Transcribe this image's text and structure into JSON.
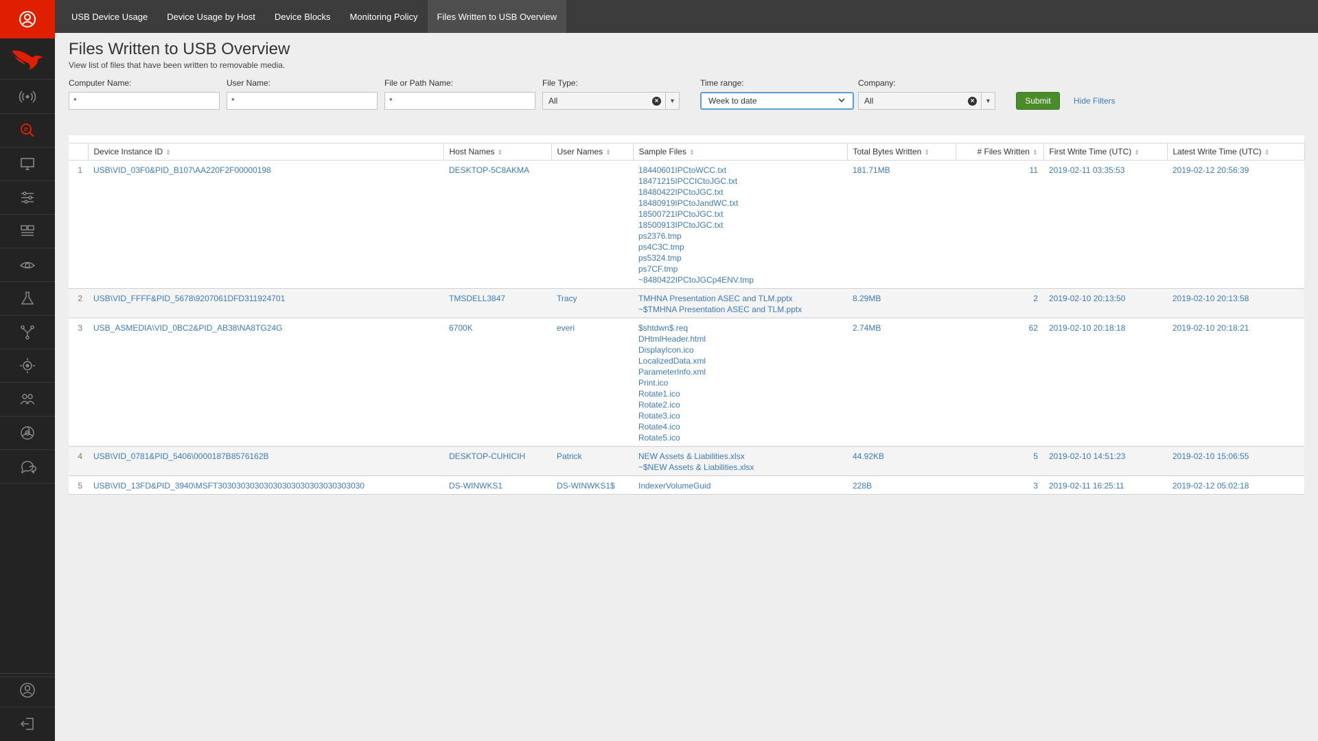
{
  "nav": {
    "tabs": [
      {
        "label": "USB Device Usage"
      },
      {
        "label": "Device Usage by Host"
      },
      {
        "label": "Device Blocks"
      },
      {
        "label": "Monitoring Policy"
      },
      {
        "label": "Files Written to USB Overview",
        "active": true
      }
    ]
  },
  "header": {
    "title": "Files Written to USB Overview",
    "subtitle": "View list of files that have been written to removable media."
  },
  "filters": {
    "computer_name": {
      "label": "Computer Name:",
      "value": "*"
    },
    "user_name": {
      "label": "User Name:",
      "value": "*"
    },
    "file_path": {
      "label": "File or Path Name:",
      "value": "*"
    },
    "file_type": {
      "label": "File Type:",
      "value": "All"
    },
    "time_range": {
      "label": "Time range:",
      "value": "Week to date"
    },
    "company": {
      "label": "Company:",
      "value": "All"
    },
    "submit_label": "Submit",
    "hide_filters_label": "Hide Filters"
  },
  "table": {
    "columns": [
      "",
      "Device Instance ID",
      "Host Names",
      "User Names",
      "Sample Files",
      "Total Bytes Written",
      "# Files Written",
      "First Write Time (UTC)",
      "Latest Write Time (UTC)"
    ],
    "rows": [
      {
        "idx": "1",
        "device_id": "USB\\VID_03F0&PID_B107\\AA220F2F00000198",
        "host": "DESKTOP-5C8AKMA",
        "user": "",
        "files": [
          "18440601IPCtoWCC.txt",
          "18471215IPCCICtoJGC.txt",
          "18480422IPCtoJGC.txt",
          "18480919IPCtoJandWC.txt",
          "18500721IPCtoJGC.txt",
          "18500913IPCtoJGC.txt",
          "ps2376.tmp",
          "ps4C3C.tmp",
          "ps5324.tmp",
          "ps7CF.tmp",
          "~8480422IPCtoJGCp4ENV.tmp"
        ],
        "bytes": "181.71MB",
        "count": "11",
        "first": "2019-02-11 03:35:53",
        "latest": "2019-02-12 20:56:39"
      },
      {
        "idx": "2",
        "device_id": "USB\\VID_FFFF&PID_5678\\9207061DFD311924701",
        "host": "TMSDELL3847",
        "user": "Tracy",
        "files": [
          "TMHNA Presentation ASEC and TLM.pptx",
          "~$TMHNA Presentation ASEC and TLM.pptx"
        ],
        "bytes": "8.29MB",
        "count": "2",
        "first": "2019-02-10 20:13:50",
        "latest": "2019-02-10 20:13:58"
      },
      {
        "idx": "3",
        "device_id": "USB_ASMEDIA\\VID_0BC2&PID_AB38\\NA8TG24G",
        "host": "6700K",
        "user": "everi",
        "files": [
          "$shtdwn$.req",
          "DHtmlHeader.html",
          "DisplayIcon.ico",
          "LocalizedData.xml",
          "ParameterInfo.xml",
          "Print.ico",
          "Rotate1.ico",
          "Rotate2.ico",
          "Rotate3.ico",
          "Rotate4.ico",
          "Rotate5.ico"
        ],
        "bytes": "2.74MB",
        "count": "62",
        "first": "2019-02-10 20:18:18",
        "latest": "2019-02-10 20:18:21"
      },
      {
        "idx": "4",
        "device_id": "USB\\VID_0781&PID_5406\\0000187B8576162B",
        "host": "DESKTOP-CUHICIH",
        "user": "Patrick",
        "files": [
          "NEW Assets & Liabilities.xlsx",
          "~$NEW Assets & Liabilities.xlsx"
        ],
        "bytes": "44.92KB",
        "count": "5",
        "first": "2019-02-10 14:51:23",
        "latest": "2019-02-10 15:06:55"
      },
      {
        "idx": "5",
        "device_id": "USB\\VID_13FD&PID_3940\\MSFT30303030303030303030303030303030",
        "host": "DS-WINWKS1",
        "user": "DS-WINWKS1$",
        "files": [
          "IndexerVolumeGuid"
        ],
        "bytes": "228B",
        "count": "3",
        "first": "2019-02-11 16:25:11",
        "latest": "2019-02-12 05:02:18"
      }
    ]
  },
  "sidebar": {
    "items": [
      "user-circle-icon",
      "falcon-logo",
      "radio-wave-icon",
      "search-threat-icon",
      "monitor-icon",
      "sliders-icon",
      "dashboard-icon",
      "eye-icon",
      "flask-icon",
      "network-icon",
      "target-icon",
      "users-icon",
      "biohazard-icon",
      "chat-icon",
      "account-icon",
      "logout-icon"
    ]
  },
  "colors": {
    "accent_red": "#e01e00",
    "link_blue": "#3d7ab8",
    "submit_green": "#4a8c2a",
    "nav_bg": "#3c3c3c",
    "sidebar_bg": "#232323"
  }
}
